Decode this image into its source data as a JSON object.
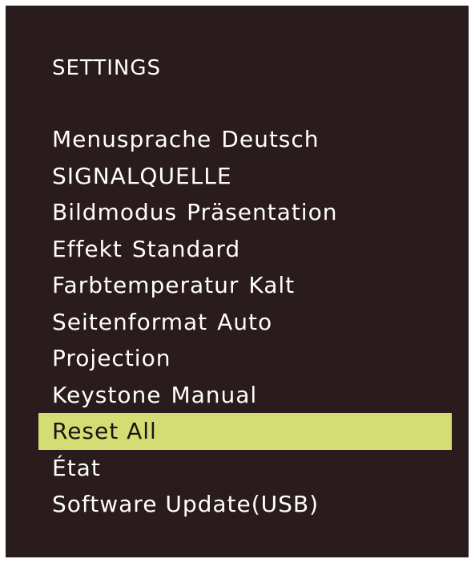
{
  "menu": {
    "title": "SETTINGS",
    "highlight_color": "#d4dc74",
    "background_color": "#2a1b1c",
    "selected_index": 8,
    "items": [
      {
        "label": "Menusprache",
        "value": "Deutsch"
      },
      {
        "label": "SIGNALQUELLE",
        "value": ""
      },
      {
        "label": "Bildmodus",
        "value": "Präsentation"
      },
      {
        "label": "Effekt",
        "value": "Standard"
      },
      {
        "label": "Farbtemperatur",
        "value": "Kalt"
      },
      {
        "label": "Seitenformat",
        "value": "Auto"
      },
      {
        "label": "Projection",
        "value": ""
      },
      {
        "label": "Keystone",
        "value": "Manual"
      },
      {
        "label": "Reset All",
        "value": ""
      },
      {
        "label": "État",
        "value": ""
      },
      {
        "label": "Software Update(USB)",
        "value": ""
      }
    ]
  }
}
